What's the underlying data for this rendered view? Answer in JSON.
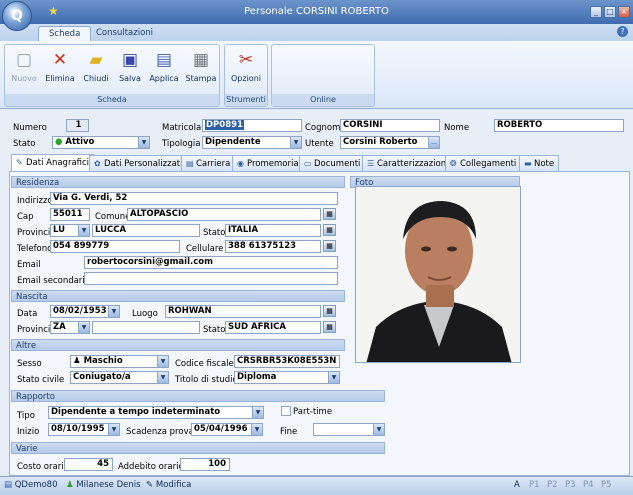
{
  "window": {
    "title": "Personale CORSINI ROBERTO"
  },
  "ribbon_tabs": [
    "Scheda",
    "Consultazioni"
  ],
  "ribbon": {
    "groups": [
      {
        "label": "Scheda",
        "buttons": [
          "Nuovo",
          "Elimina",
          "Chiudi",
          "Salva",
          "Applica",
          "Stampa"
        ]
      },
      {
        "label": "Strumenti",
        "buttons": [
          "Opzioni"
        ]
      },
      {
        "label": "Online",
        "buttons": []
      }
    ]
  },
  "header": {
    "numero_label": "Numero",
    "numero": "1",
    "matricola_label": "Matricola",
    "matricola": "DP0891",
    "cognome_label": "Cognome",
    "cognome": "CORSINI",
    "nome_label": "Nome",
    "nome": "ROBERTO",
    "stato_label": "Stato",
    "stato": "Attivo",
    "tipologia_label": "Tipologia",
    "tipologia": "Dipendente",
    "utente_label": "Utente",
    "utente": "Corsini Roberto"
  },
  "form_tabs": [
    "Dati Anagrafici",
    "Dati Personalizzati",
    "Carriera",
    "Promemoria",
    "Documenti",
    "Caratterizzazioni",
    "Collegamenti",
    "Note"
  ],
  "residenza": {
    "section": "Residenza",
    "indirizzo_label": "Indirizzo",
    "indirizzo": "Via G. Verdi, 52",
    "cap_label": "Cap",
    "cap": "55011",
    "comune_label": "Comune",
    "comune": "ALTOPASCIO",
    "provincia_label": "Provincia",
    "provincia": "LU",
    "provincia_nome": "LUCCA",
    "stato_label": "Stato",
    "stato": "ITALIA",
    "telefono_label": "Telefono",
    "telefono": "054 899779",
    "cellulare_label": "Cellulare",
    "cellulare": "388 61375123",
    "email_label": "Email",
    "email": "robertocorsini@gmail.com",
    "email2_label": "Email secondaria",
    "email2": ""
  },
  "foto": {
    "section": "Foto"
  },
  "nascita": {
    "section": "Nascita",
    "data_label": "Data",
    "data": "08/02/1953",
    "luogo_label": "Luogo",
    "luogo": "ROHWAN",
    "provincia_label": "Provincia",
    "provincia": "ZA",
    "provincia_nome": "",
    "stato_label": "Stato",
    "stato": "SUD AFRICA"
  },
  "altre": {
    "section": "Altre",
    "sesso_label": "Sesso",
    "sesso": "Maschio",
    "cf_label": "Codice fiscale",
    "cf": "CRSRBR53K08E553N",
    "stato_civile_label": "Stato civile",
    "stato_civile": "Coniugato/a",
    "titolo_label": "Titolo di studio",
    "titolo": "Diploma"
  },
  "rapporto": {
    "section": "Rapporto",
    "tipo_label": "Tipo",
    "tipo": "Dipendente a tempo indeterminato",
    "parttime_label": "Part-time",
    "inizio_label": "Inizio",
    "inizio": "08/10/1995",
    "scadenza_label": "Scadenza prova",
    "scadenza": "05/04/1996",
    "fine_label": "Fine",
    "fine": ""
  },
  "varie": {
    "section": "Varie",
    "costo_label": "Costo orario",
    "costo": "45",
    "addebito_label": "Addebito orario",
    "addebito": "100"
  },
  "statusbar": {
    "db": "QDemo80",
    "user": "Milanese Denis",
    "mode": "Modifica",
    "panels": [
      "A",
      "P1",
      "P2",
      "P3",
      "P4",
      "P5"
    ]
  },
  "colors": {
    "titlebar": "#3e6cb0",
    "accent": "#2e5ea6"
  }
}
